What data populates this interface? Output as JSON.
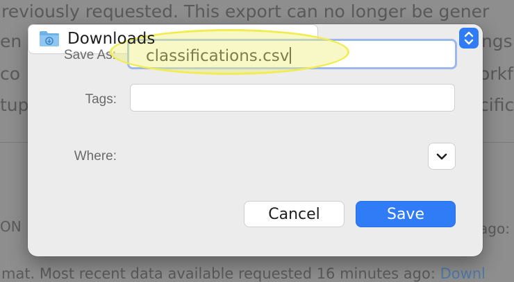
{
  "background": {
    "line1": "reviously requested. This export can no longer be gener",
    "line2": "en n",
    "line2_right": "ings",
    "line3": " co",
    "line3_right": "orkf",
    "line4": "tup",
    "line4_right": "cific",
    "line5": "ON",
    "line5_right": "ago:",
    "line6": "mat. Most recent data available requested 16 minutes ago: ",
    "line6_link": "Downl"
  },
  "dialog": {
    "save_as_label": "Save As:",
    "filename": "classifications.csv",
    "tags_label": "Tags:",
    "tags_value": "",
    "where_label": "Where:",
    "where_value": "Downloads",
    "cancel_label": "Cancel",
    "save_label": "Save"
  },
  "colors": {
    "accent": "#2f7cf6",
    "highlight": "#f2ec53"
  },
  "icons": {
    "folder": "downloads-folder-icon",
    "stepper": "up-down-chevron-icon",
    "expand": "chevron-down-icon"
  }
}
